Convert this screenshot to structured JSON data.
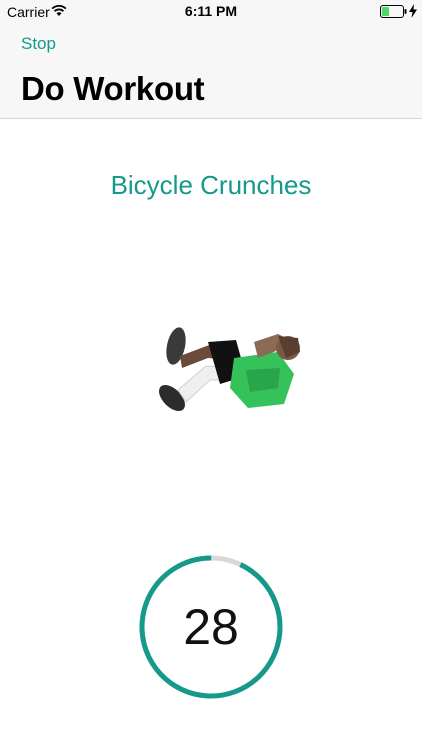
{
  "status_bar": {
    "carrier": "Carrier",
    "time": "6:11 PM",
    "battery_color": "#4cd964"
  },
  "navbar": {
    "back_label": "Stop",
    "title": "Do Workout"
  },
  "workout": {
    "exercise_name": "Bicycle Crunches",
    "timer_value": "28",
    "timer_progress_fraction": 0.93
  },
  "colors": {
    "accent": "#14998a",
    "track": "#d9d9d9"
  }
}
